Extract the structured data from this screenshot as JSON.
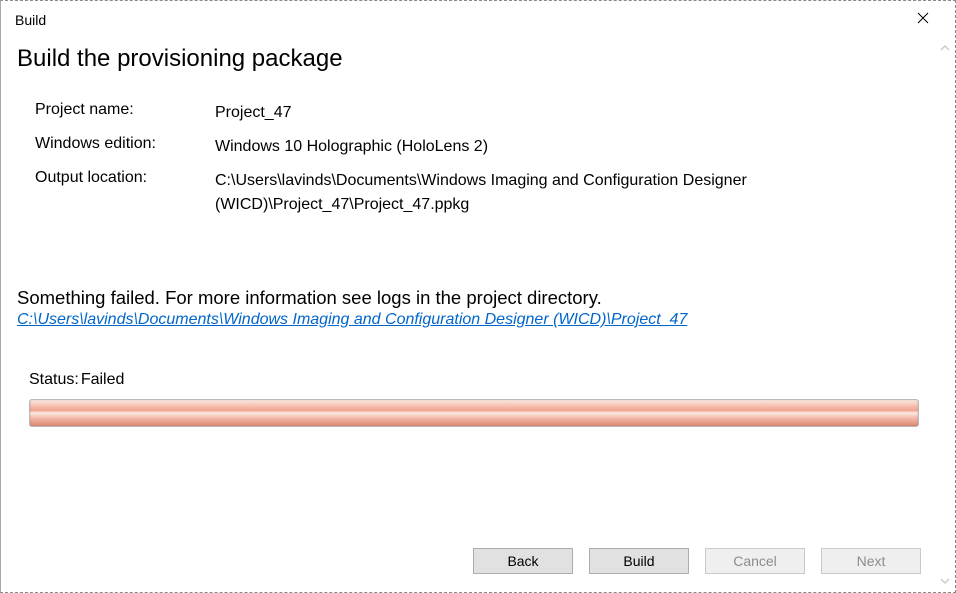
{
  "window": {
    "title": "Build"
  },
  "page": {
    "heading": "Build the provisioning package"
  },
  "info": {
    "projectName": {
      "label": "Project name:",
      "value": "Project_47"
    },
    "windowsEdition": {
      "label": "Windows edition:",
      "value": "Windows 10 Holographic (HoloLens 2)"
    },
    "outputLocation": {
      "label": "Output location:",
      "value": "C:\\Users\\lavinds\\Documents\\Windows Imaging and Configuration Designer (WICD)\\Project_47\\Project_47.ppkg"
    }
  },
  "error": {
    "message": "Something failed. For more information see logs in the project directory.",
    "link": "C:\\Users\\lavinds\\Documents\\Windows Imaging and Configuration Designer (WICD)\\Project_47"
  },
  "status": {
    "label": "Status:",
    "value": "Failed"
  },
  "buttons": {
    "back": "Back",
    "build": "Build",
    "cancel": "Cancel",
    "next": "Next"
  }
}
